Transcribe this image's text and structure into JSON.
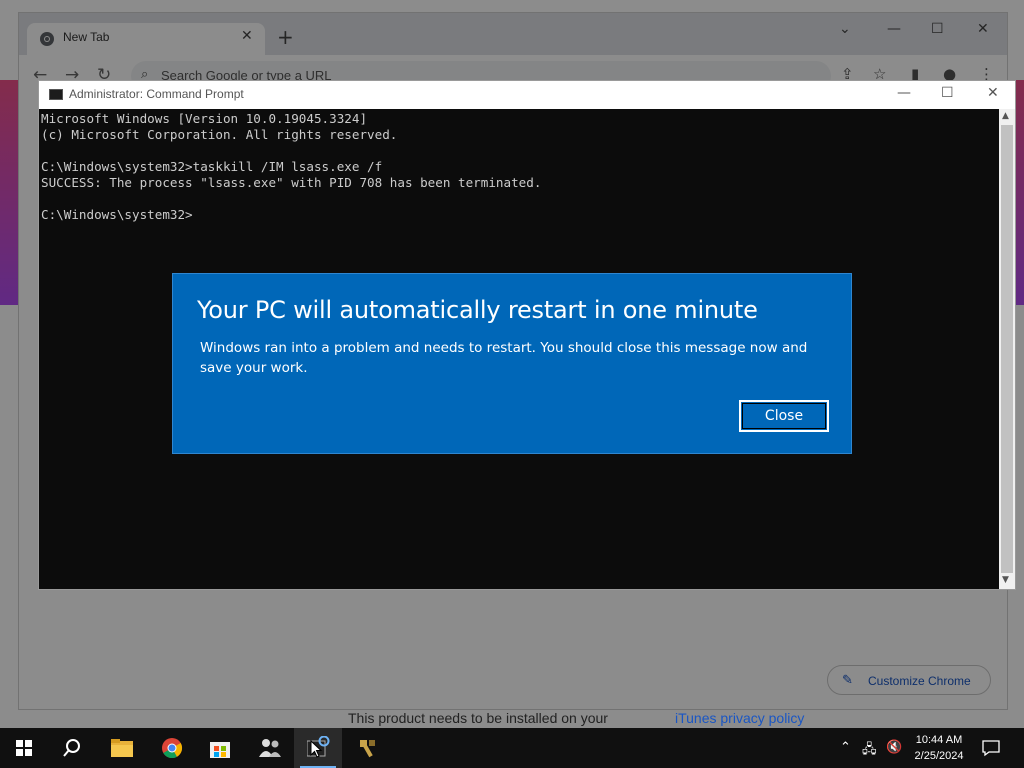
{
  "chrome": {
    "tab_title": "New Tab",
    "tab_close": "✕",
    "new_tab": "+",
    "omnibox_placeholder": "Search Google or type a URL",
    "customize_label": "Customize Chrome"
  },
  "page_bottom": {
    "text_left": "This product needs to be installed on your",
    "text_link": "iTunes privacy policy"
  },
  "cmd": {
    "title": "Administrator: Command Prompt",
    "console_text": "Microsoft Windows [Version 10.0.19045.3324]\n(c) Microsoft Corporation. All rights reserved.\n\nC:\\Windows\\system32>taskkill /IM lsass.exe /f\nSUCCESS: The process \"lsass.exe\" with PID 708 has been terminated.\n\nC:\\Windows\\system32>"
  },
  "dialog": {
    "heading": "Your PC will automatically restart in one minute",
    "message": "Windows ran into a problem and needs to restart. You should close this message now and save your work.",
    "close_label": "Close",
    "background_color": "#0067b8"
  },
  "taskbar": {
    "time": "10:44 AM",
    "date": "2/25/2024",
    "apps": [
      "windows-start-icon",
      "search-icon",
      "file-explorer-icon",
      "chrome-icon",
      "microsoft-store-icon",
      "people-icon",
      "cmd-icon",
      "tool-icon"
    ]
  }
}
